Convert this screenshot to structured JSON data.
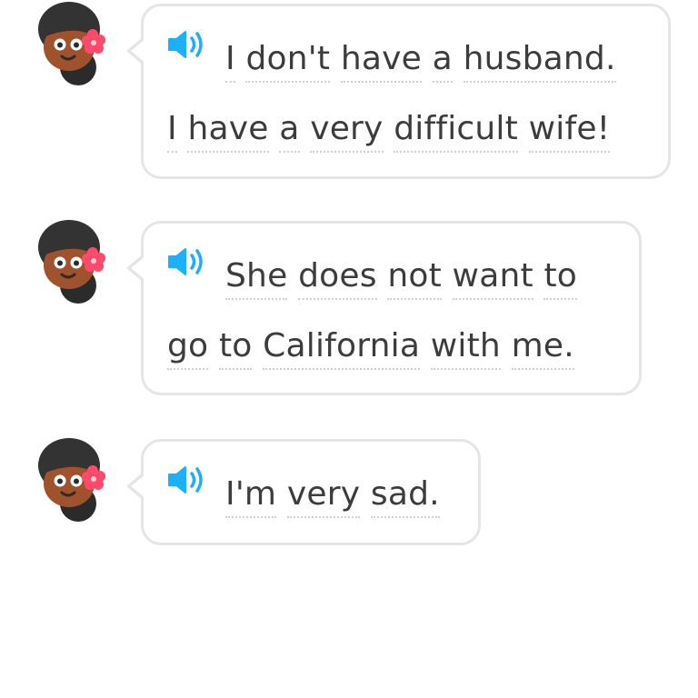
{
  "messages": [
    {
      "lines": [
        [
          "I",
          "don't",
          "have",
          "a",
          "husband."
        ],
        [
          "I",
          "have",
          "a",
          "very",
          "difficult",
          "wife!"
        ]
      ],
      "icon": "speaker-icon"
    },
    {
      "lines": [
        [
          "She",
          "does",
          "not",
          "want",
          "to"
        ],
        [
          "go",
          "to",
          "California",
          "with",
          "me."
        ]
      ],
      "icon": "speaker-icon"
    },
    {
      "lines": [
        [
          "I'm",
          "very",
          "sad."
        ]
      ],
      "icon": "speaker-icon"
    }
  ],
  "colors": {
    "speaker": "#1cb0f6",
    "text": "#3c3c3c",
    "bubble_border": "#e5e5e5",
    "skin": "#a0522d",
    "hair": "#333333",
    "flower": "#ff4b6b"
  }
}
